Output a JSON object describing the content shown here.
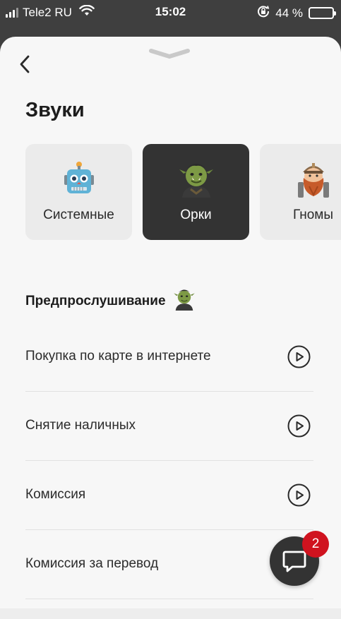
{
  "status_bar": {
    "carrier": "Tele2 RU",
    "time": "15:02",
    "battery_text": "44 %",
    "battery_level": 0.44
  },
  "screen": {
    "title": "Звуки"
  },
  "sound_packs": [
    {
      "label": "Системные",
      "icon": "robot-icon",
      "selected": false
    },
    {
      "label": "Орки",
      "icon": "orc-icon",
      "selected": true
    },
    {
      "label": "Гномы",
      "icon": "dwarf-icon",
      "selected": false
    }
  ],
  "preview": {
    "title": "Предпрослушивание",
    "icon": "orc-icon"
  },
  "sounds": [
    {
      "label": "Покупка по карте в интернете",
      "icon": "play-icon"
    },
    {
      "label": "Снятие наличных",
      "icon": "play-icon"
    },
    {
      "label": "Комиссия",
      "icon": "play-icon"
    },
    {
      "label": "Комиссия за перевод",
      "icon": "play-icon"
    }
  ],
  "chat": {
    "icon": "chat-icon",
    "badge_count": "2",
    "badge_color": "#d0131f"
  },
  "colors": {
    "selected_card": "#333333",
    "card": "#ebebeb",
    "sheet": "#f7f7f7"
  }
}
